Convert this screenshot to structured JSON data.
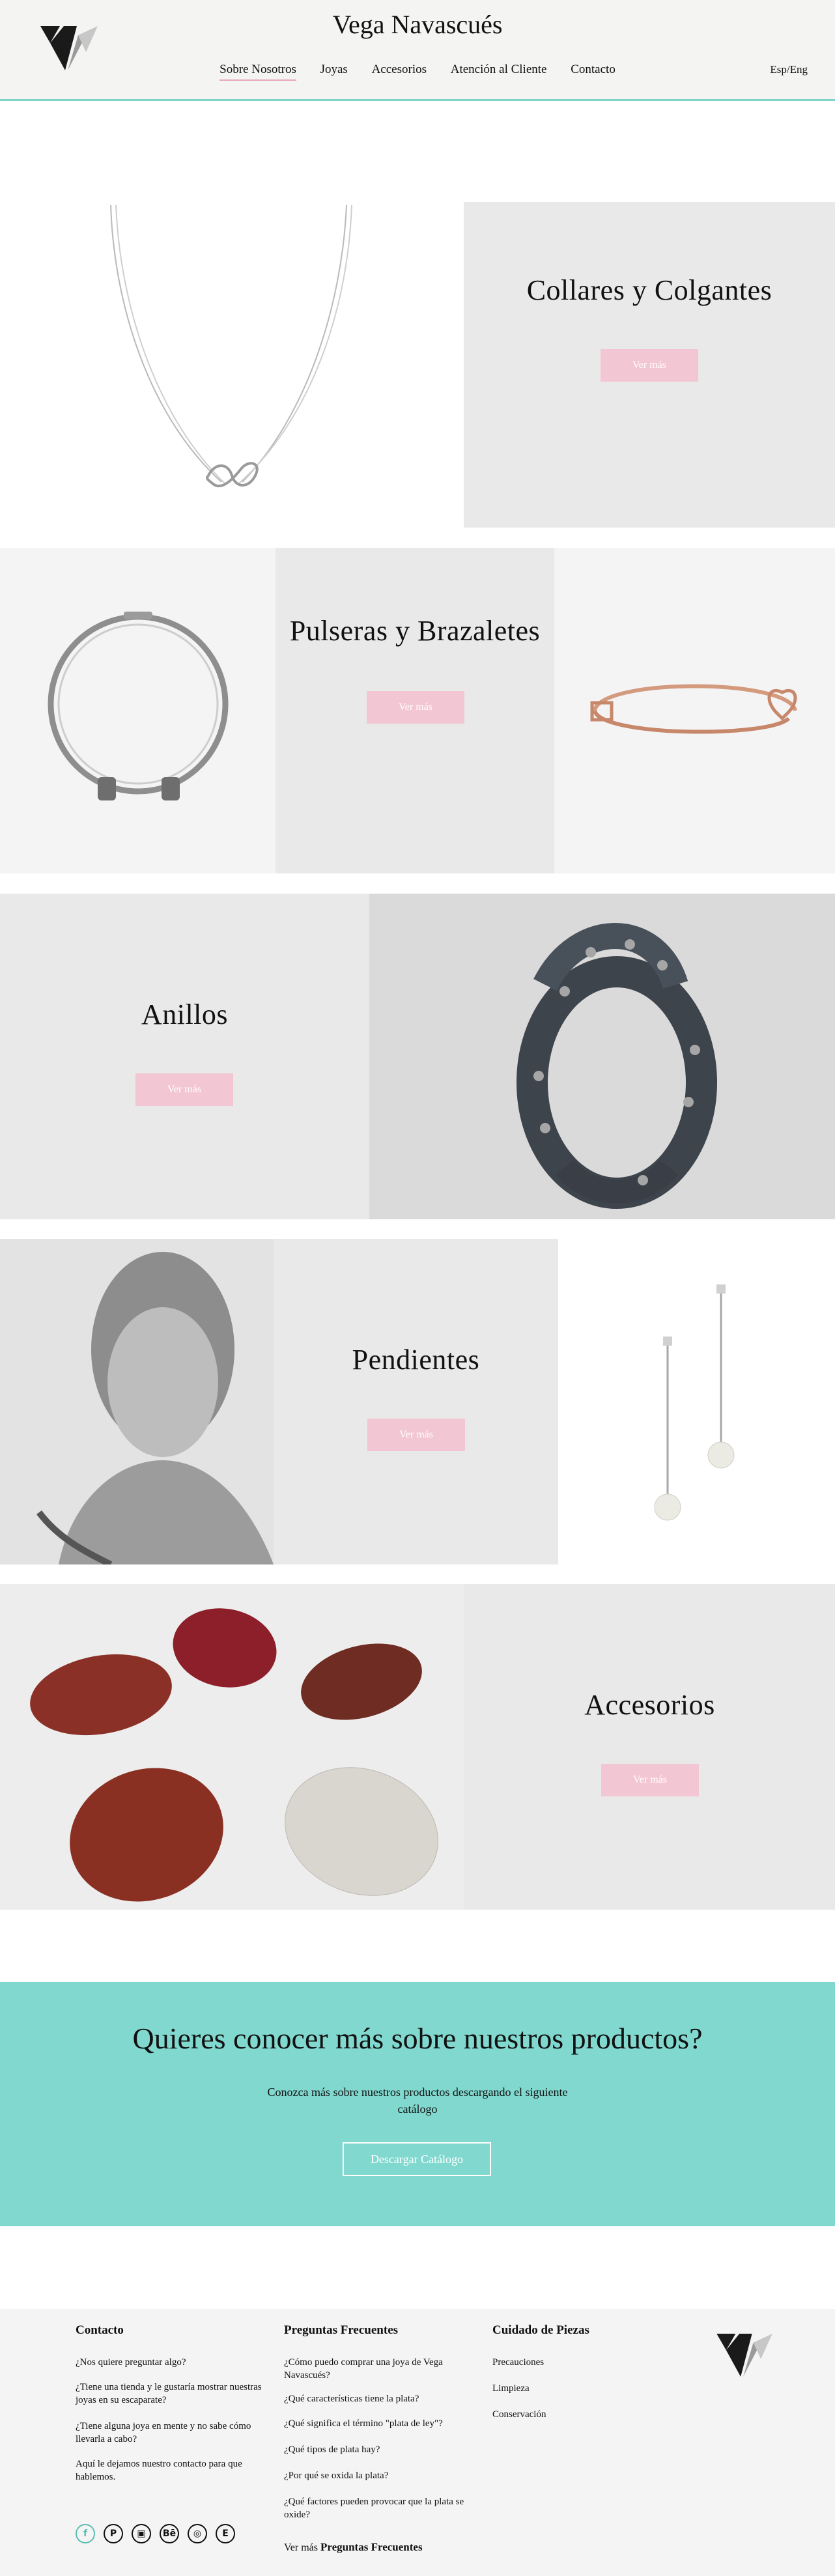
{
  "header": {
    "title": "Vega Navascués",
    "nav": [
      "Sobre Nosotros",
      "Joyas",
      "Accesorios",
      "Atención al Cliente",
      "Contacto"
    ],
    "lang": "Esp/Eng"
  },
  "sections": {
    "collares": {
      "title": "Collares y Colgantes",
      "button": "Ver más"
    },
    "pulseras": {
      "title": "Pulseras y Brazaletes",
      "button": "Ver más"
    },
    "anillos": {
      "title": "Anillos",
      "button": "Ver más"
    },
    "pendientes": {
      "title": "Pendientes",
      "button": "Ver más"
    },
    "accesorios": {
      "title": "Accesorios",
      "button": "Ver más"
    }
  },
  "cta": {
    "title": "Quieres conocer más sobre nuestros productos?",
    "text": "Conozca más sobre nuestros productos descargando el siguiente catálogo",
    "button": "Descargar Catálogo"
  },
  "footer": {
    "contacto": {
      "heading": "Contacto",
      "links": [
        "¿Nos quiere preguntar algo?",
        "¿Tiene una tienda y le gustaría mostrar nuestras joyas en su escaparate?",
        "¿Tiene alguna joya en mente y no sabe cómo llevarla a cabo?",
        "Aquí le dejamos nuestro contacto para que hablemos."
      ]
    },
    "faq": {
      "heading": "Preguntas Frecuentes",
      "links": [
        "¿Cómo puedo comprar una joya de Vega Navascués?",
        "¿Qué características tiene la plata?",
        "¿Qué significa el término \"plata de ley\"?",
        "¿Qué tipos de plata hay?",
        "¿Por qué se oxida la plata?",
        "¿Qué factores pueden provocar que la plata se oxide?"
      ],
      "more_prefix": "Ver más",
      "more_bold": "Preguntas Frecuentes"
    },
    "cuidado": {
      "heading": "Cuidado de Piezas",
      "links": [
        "Precauciones",
        "Limpieza",
        "Conservación"
      ]
    },
    "social": [
      "f",
      "P",
      "▣",
      "Bē",
      "◎",
      "E"
    ]
  },
  "colors": {
    "accent_teal": "#80d8cf",
    "button_pink": "#f3c6d3",
    "panel_grey": "#e9e9e9"
  }
}
